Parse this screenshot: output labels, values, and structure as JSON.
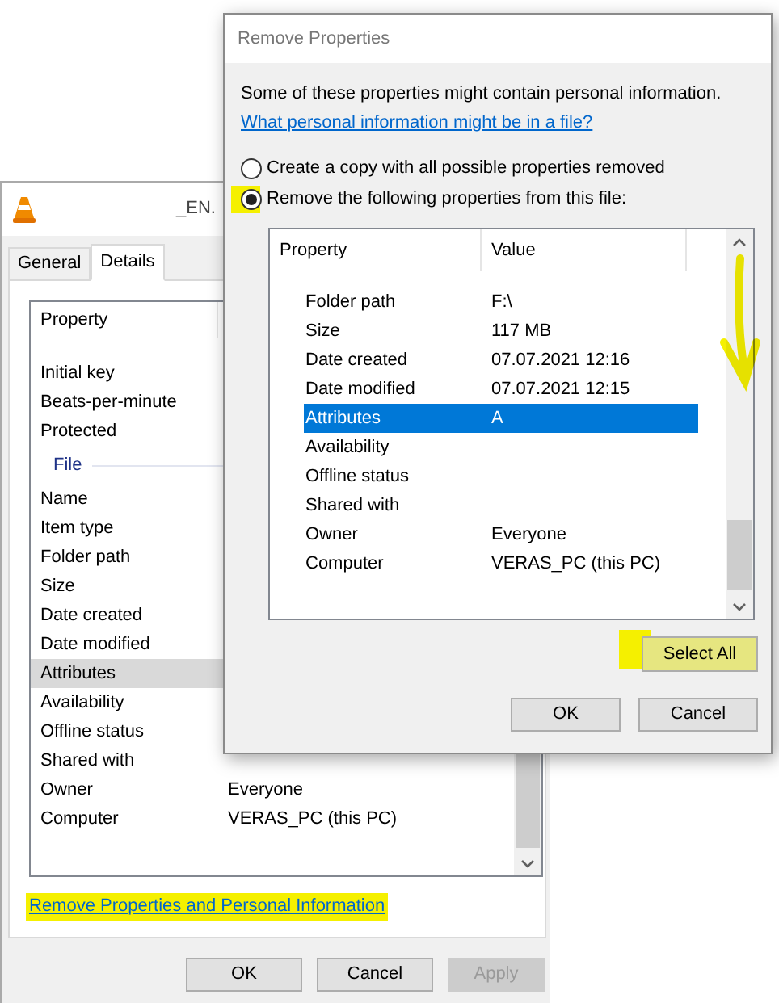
{
  "properties_window": {
    "title": "_EN.",
    "tabs": [
      {
        "label": "General",
        "selected": false
      },
      {
        "label": "Details",
        "selected": true
      }
    ],
    "columns": [
      "Property"
    ],
    "rows": [
      {
        "kind": "row",
        "property": "Initial key",
        "selected": false
      },
      {
        "kind": "row",
        "property": "Beats-per-minute",
        "selected": false
      },
      {
        "kind": "row",
        "property": "Protected",
        "selected": false
      },
      {
        "kind": "heading",
        "property": "File"
      },
      {
        "kind": "row",
        "property": "Name",
        "selected": false
      },
      {
        "kind": "row",
        "property": "Item type",
        "selected": false
      },
      {
        "kind": "row",
        "property": "Folder path",
        "selected": false
      },
      {
        "kind": "row",
        "property": "Size",
        "selected": false
      },
      {
        "kind": "row",
        "property": "Date created",
        "selected": false
      },
      {
        "kind": "row",
        "property": "Date modified",
        "selected": false
      },
      {
        "kind": "row",
        "property": "Attributes",
        "selected": true
      },
      {
        "kind": "row",
        "property": "Availability",
        "selected": false
      },
      {
        "kind": "row",
        "property": "Offline status",
        "selected": false
      },
      {
        "kind": "row",
        "property": "Shared with",
        "selected": false
      },
      {
        "kind": "row",
        "property": "Owner",
        "value": "Everyone",
        "selected": false
      },
      {
        "kind": "row",
        "property": "Computer",
        "value": "VERAS_PC (this PC)",
        "selected": false
      }
    ],
    "link": "Remove Properties and Personal Information",
    "buttons": [
      {
        "label": "OK",
        "disabled": false
      },
      {
        "label": "Cancel",
        "disabled": false
      },
      {
        "label": "Apply",
        "disabled": true
      }
    ]
  },
  "remove_dialog": {
    "title": "Remove Properties",
    "intro": "Some of these properties might contain personal information.",
    "link": "What personal information might be in a file?",
    "options": [
      {
        "label": "Create a copy with all possible properties removed",
        "selected": false
      },
      {
        "label": "Remove the following properties from this file:",
        "selected": true
      }
    ],
    "columns": [
      "Property",
      "Value"
    ],
    "rows": [
      {
        "property": "Folder path",
        "value": "F:\\",
        "selected": false
      },
      {
        "property": "Size",
        "value": "117 MB",
        "selected": false
      },
      {
        "property": "Date created",
        "value": "07.07.2021 12:16",
        "selected": false
      },
      {
        "property": "Date modified",
        "value": "07.07.2021 12:15",
        "selected": false
      },
      {
        "property": "Attributes",
        "value": "A",
        "selected": true
      },
      {
        "property": "Availability",
        "selected": false
      },
      {
        "property": "Offline status",
        "selected": false
      },
      {
        "property": "Shared with",
        "selected": false
      },
      {
        "property": "Owner",
        "value": "Everyone",
        "selected": false
      },
      {
        "property": "Computer",
        "value": "VERAS_PC (this PC)",
        "selected": false
      }
    ],
    "select_all": "Select All",
    "buttons": [
      {
        "label": "OK",
        "disabled": false
      },
      {
        "label": "Cancel",
        "disabled": false
      }
    ]
  }
}
